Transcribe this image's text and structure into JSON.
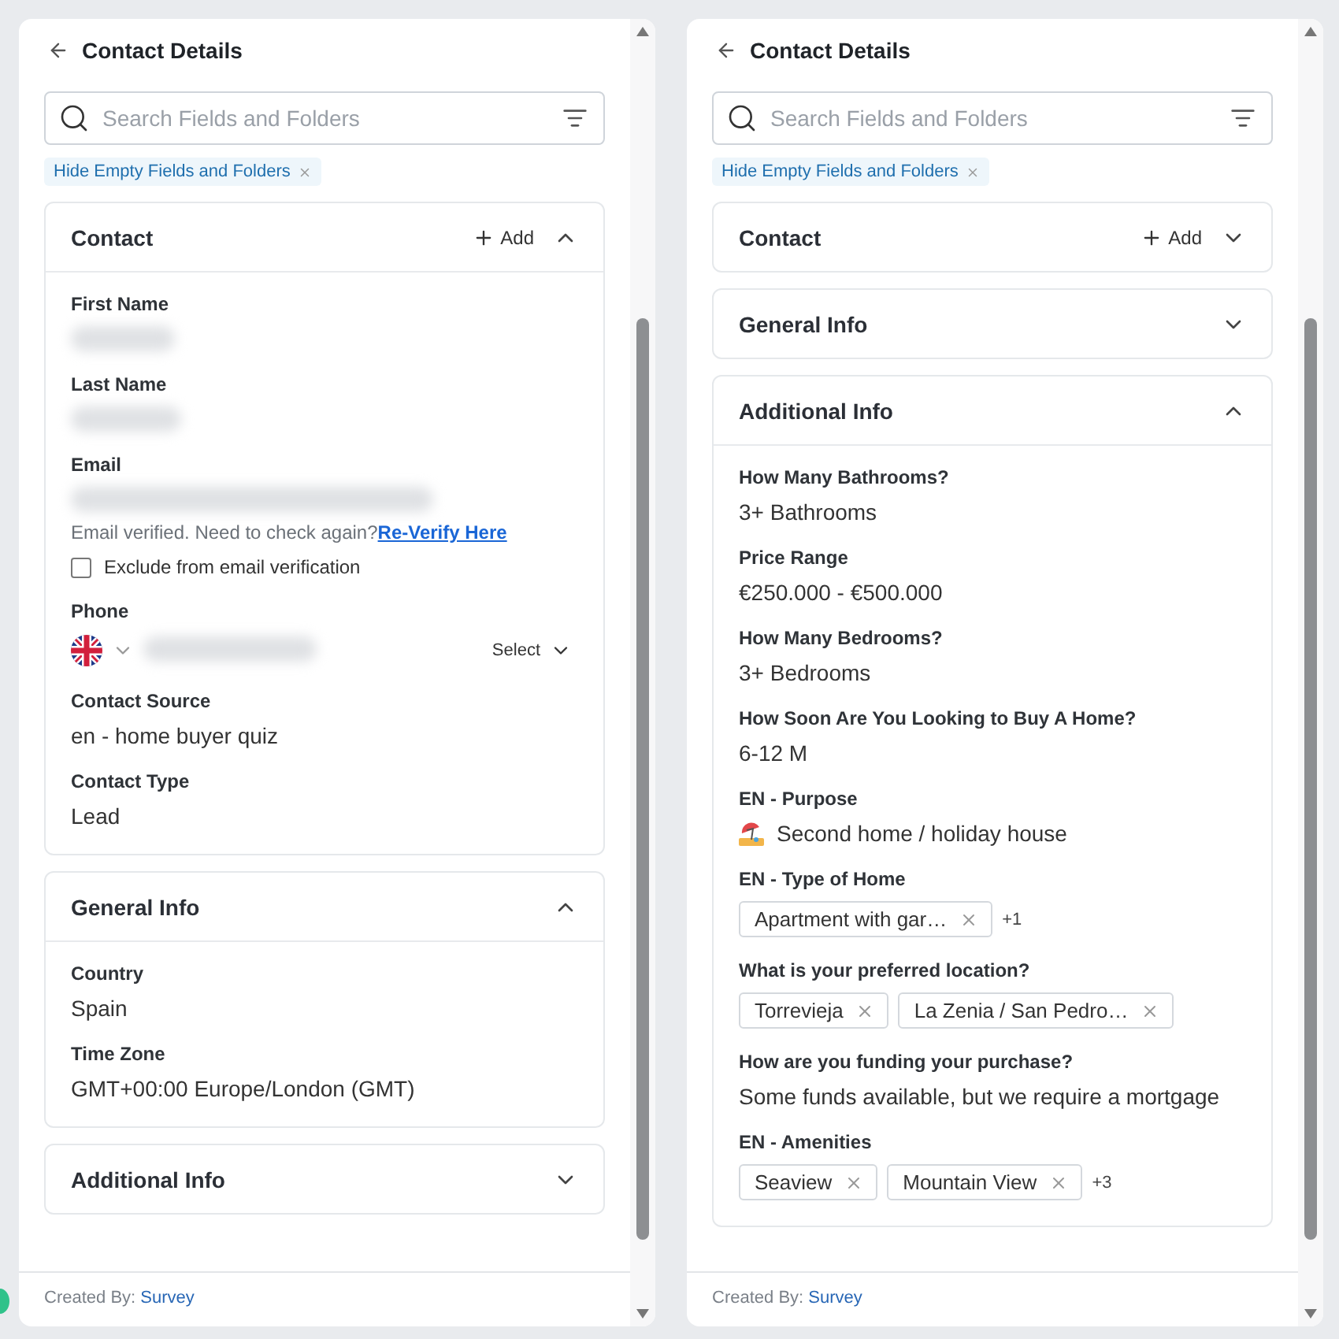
{
  "panels": [
    {
      "title": "Contact Details",
      "search": {
        "placeholder": "Search Fields and Folders"
      },
      "filter_chip": "Hide Empty Fields and Folders",
      "sections": [
        {
          "title": "Contact",
          "add": "Add",
          "expanded": true,
          "fields": [
            {
              "kind": "redacted",
              "label": "First Name"
            },
            {
              "kind": "redacted",
              "label": "Last Name"
            },
            {
              "kind": "email",
              "label": "Email",
              "note": "Email verified. Need to check again?",
              "link": "Re-Verify Here",
              "checkbox": {
                "label": "Exclude from email verification",
                "checked": false
              }
            },
            {
              "kind": "phone",
              "label": "Phone",
              "select": "Select"
            },
            {
              "kind": "text",
              "label": "Contact Source",
              "value": "en - home buyer quiz"
            },
            {
              "kind": "text",
              "label": "Contact Type",
              "value": "Lead"
            }
          ]
        },
        {
          "title": "General Info",
          "expanded": true,
          "fields": [
            {
              "kind": "text",
              "label": "Country",
              "value": "Spain"
            },
            {
              "kind": "text",
              "label": "Time Zone",
              "value": "GMT+00:00 Europe/London (GMT)"
            }
          ]
        },
        {
          "title": "Additional Info",
          "expanded": false
        }
      ],
      "footer": {
        "label": "Created By:",
        "link": "Survey"
      }
    },
    {
      "title": "Contact Details",
      "search": {
        "placeholder": "Search Fields and Folders"
      },
      "filter_chip": "Hide Empty Fields and Folders",
      "sections": [
        {
          "title": "Contact",
          "add": "Add",
          "expanded": false
        },
        {
          "title": "General Info",
          "expanded": false
        },
        {
          "title": "Additional Info",
          "expanded": true,
          "fields": [
            {
              "kind": "text",
              "label": "How Many Bathrooms?",
              "value": "3+ Bathrooms"
            },
            {
              "kind": "text",
              "label": "Price Range",
              "value": "€250.000 - €500.000"
            },
            {
              "kind": "text",
              "label": "How Many Bedrooms?",
              "value": "3+ Bedrooms"
            },
            {
              "kind": "text",
              "label": "How Soon Are You Looking to Buy A Home?",
              "value": "6-12 M"
            },
            {
              "kind": "icon_text",
              "label": "EN - Purpose",
              "value": "Second home / holiday house"
            },
            {
              "kind": "tags",
              "label": "EN - Type of Home",
              "tags": [
                "Apartment with gar…"
              ],
              "more": "+1"
            },
            {
              "kind": "tags",
              "label": "What is your preferred location?",
              "tags": [
                "Torrevieja",
                "La Zenia / San Pedro…"
              ]
            },
            {
              "kind": "text",
              "label": "How are you funding your purchase?",
              "value": "Some funds available, but we require a mortgage"
            },
            {
              "kind": "tags",
              "label": "EN - Amenities",
              "tags": [
                "Seaview",
                "Mountain View"
              ],
              "more": "+3"
            }
          ]
        }
      ],
      "footer": {
        "label": "Created By:",
        "link": "Survey"
      }
    }
  ]
}
